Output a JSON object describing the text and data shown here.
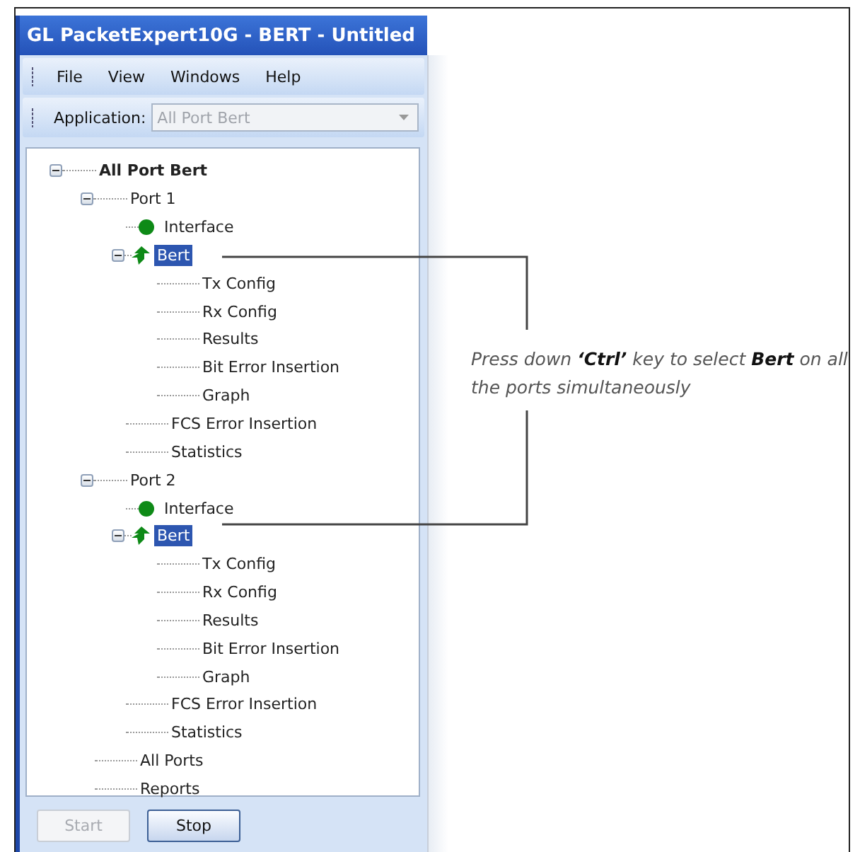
{
  "window": {
    "title": "GL PacketExpert10G - BERT - Untitled"
  },
  "menu": [
    "File",
    "View",
    "Windows",
    "Help"
  ],
  "application": {
    "label": "Application:",
    "value": "All Port Bert",
    "disabled": true
  },
  "tree": [
    {
      "label": "All Port Bert",
      "bold": true,
      "expanded": true,
      "selected": false,
      "children": [
        {
          "label": "Port 1",
          "expanded": true,
          "selected": false,
          "children": [
            {
              "label": "Interface",
              "kind": "status",
              "selected": false
            },
            {
              "label": "Bert",
              "kind": "test",
              "expanded": true,
              "selected": true,
              "children": [
                {
                  "label": "Tx Config",
                  "selected": false
                },
                {
                  "label": "Rx Config",
                  "selected": false
                },
                {
                  "label": "Results",
                  "selected": false
                },
                {
                  "label": "Bit Error Insertion",
                  "selected": false
                },
                {
                  "label": "Graph",
                  "selected": false
                }
              ]
            },
            {
              "label": "FCS Error Insertion",
              "selected": false
            },
            {
              "label": "Statistics",
              "selected": false
            }
          ]
        },
        {
          "label": "Port 2",
          "expanded": true,
          "selected": false,
          "children": [
            {
              "label": "Interface",
              "kind": "status",
              "selected": false
            },
            {
              "label": "Bert",
              "kind": "test",
              "expanded": true,
              "selected": true,
              "children": [
                {
                  "label": "Tx Config",
                  "selected": false
                },
                {
                  "label": "Rx Config",
                  "selected": false
                },
                {
                  "label": "Results",
                  "selected": false
                },
                {
                  "label": "Bit Error Insertion",
                  "selected": false
                },
                {
                  "label": "Graph",
                  "selected": false
                }
              ]
            },
            {
              "label": "FCS Error Insertion",
              "selected": false
            },
            {
              "label": "Statistics",
              "selected": false
            }
          ]
        },
        {
          "label": "All Ports",
          "selected": false
        },
        {
          "label": "Reports",
          "selected": false
        }
      ]
    }
  ],
  "buttons": [
    {
      "label": "Start",
      "disabled": true
    },
    {
      "label": "Stop",
      "disabled": false
    }
  ],
  "annotation": {
    "text": "Press down **‘Ctrl’** key to select **Bert** on all the ports simultaneously"
  }
}
